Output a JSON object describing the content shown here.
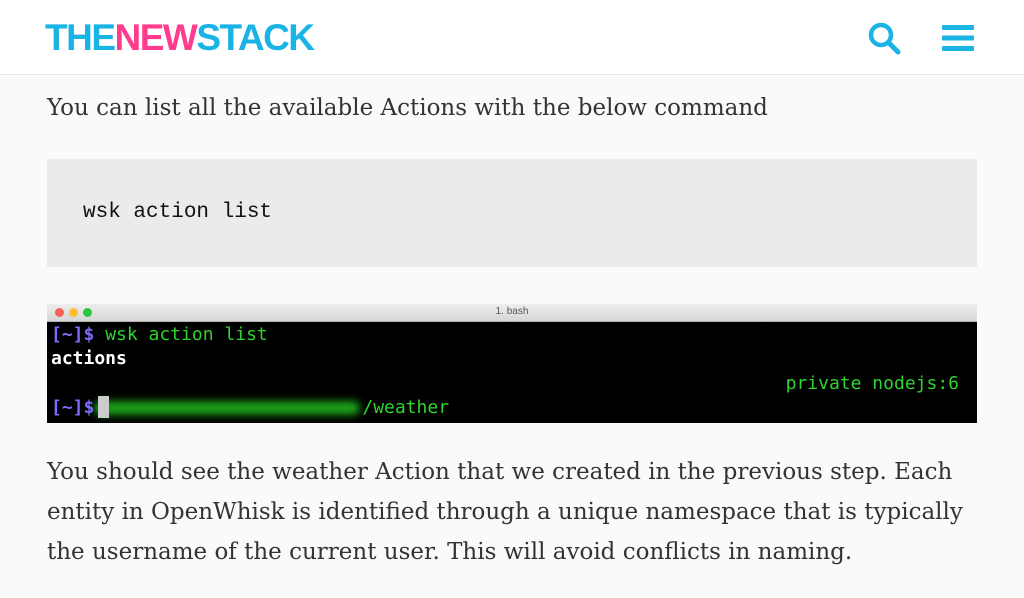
{
  "header": {
    "logo_part1": "THE",
    "logo_part2": "NEW",
    "logo_part3": "STACK",
    "search_icon": "search-icon",
    "menu_icon": "hamburger-menu-icon",
    "brand_blue": "#19b3e6",
    "brand_pink": "#ff3c8e"
  },
  "article": {
    "intro": "You can list all the available Actions with the below command",
    "code": "wsk action list",
    "body": "You should see the weather Action that we created in the previous step. Each entity in OpenWhisk is identified through a unique namespace that is typically the username of the current user. This will avoid conflicts in naming."
  },
  "terminal": {
    "title": "1. bash",
    "prompt": "[~]$",
    "command": " wsk action list",
    "line2": "actions",
    "action_path_suffix": "/weather",
    "action_meta": "private nodejs:6",
    "prompt2": "[~]$"
  }
}
